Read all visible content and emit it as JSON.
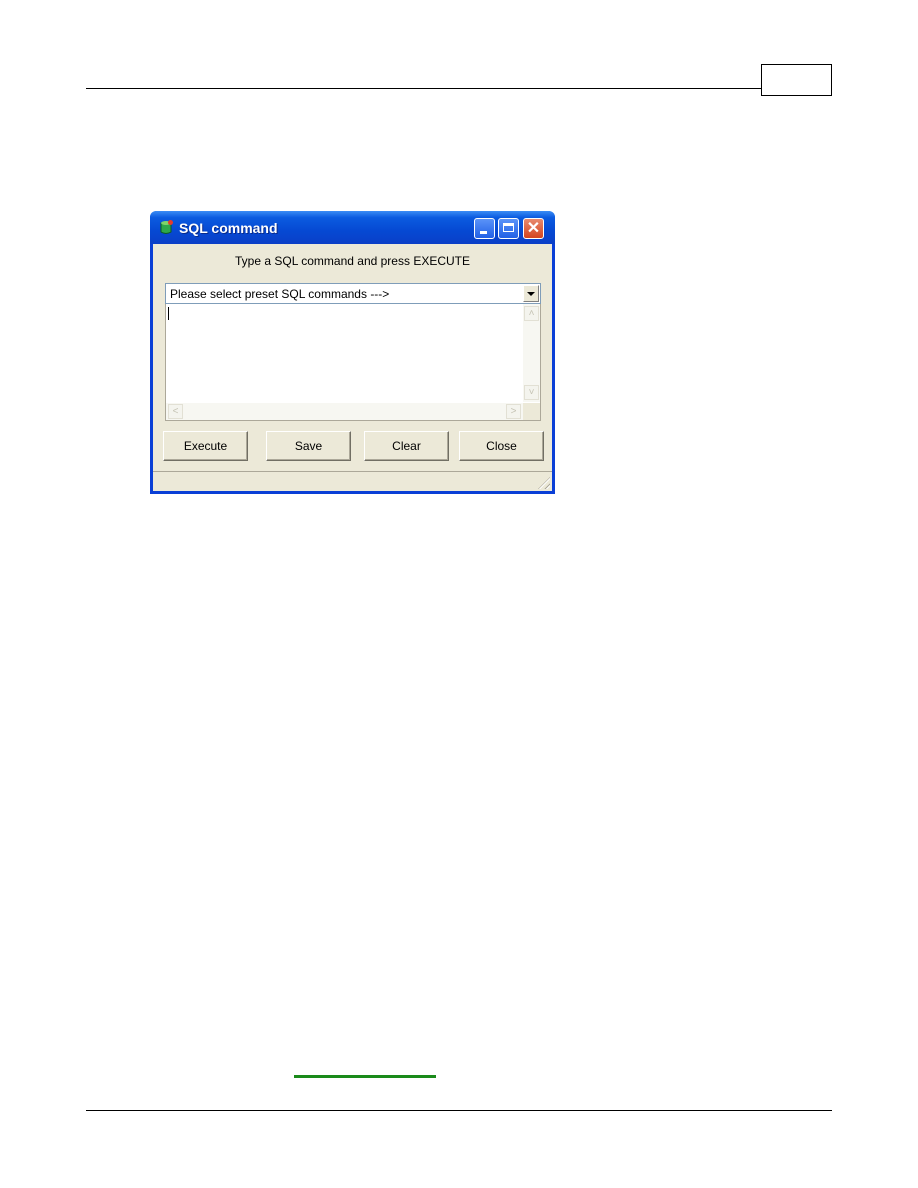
{
  "page": {
    "header_page_number": "",
    "footer_link_text": ""
  },
  "window": {
    "title": "SQL command",
    "icon": "database-app-icon",
    "controls": {
      "minimize": "minimize-icon",
      "maximize": "maximize-icon",
      "close": "✕"
    },
    "prompt": "Type a SQL command and press EXECUTE",
    "preset_combo": {
      "selected": "Please select preset SQL commands --->"
    },
    "sql_text": "",
    "buttons": {
      "execute": "Execute",
      "save": "Save",
      "clear": "Clear",
      "close": "Close"
    },
    "scroll_glyphs": {
      "up": "˄",
      "down": "˅",
      "left": "<",
      "right": ">"
    }
  }
}
